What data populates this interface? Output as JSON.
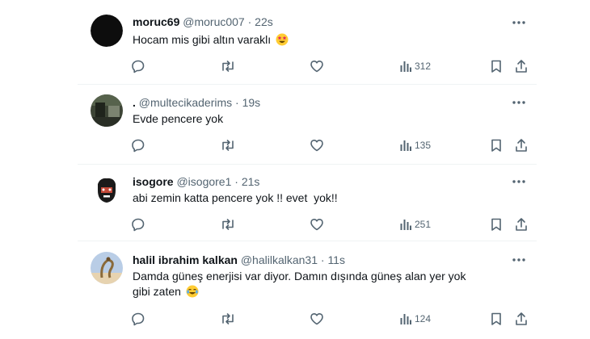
{
  "replies": [
    {
      "name": "moruc69",
      "handle": "@moruc007",
      "separator": "·",
      "time": "22s",
      "text": "Hocam mis gibi altın varaklı",
      "emoji": "star-struck-emoji",
      "views": "312"
    },
    {
      "name": ".",
      "handle": "@multecikaderims",
      "separator": "·",
      "time": "19s",
      "text": "Evde pencere yok",
      "emoji": "",
      "views": "135"
    },
    {
      "name": "isogore",
      "handle": "@isogore1",
      "separator": "·",
      "time": "21s",
      "text": "abi zemin katta pencere yok !! evet  yok!!",
      "emoji": "",
      "views": "251"
    },
    {
      "name": "halil ibrahim kalkan",
      "handle": "@halilkalkan31",
      "separator": "·",
      "time": "11s",
      "text": "Damda güneş enerjisi var diyor. Damın dışında güneş alan yer yok gibi zaten",
      "emoji": "crying-laughing-emoji",
      "views": "124"
    }
  ],
  "icons": {
    "reply": "reply-icon",
    "retweet": "retweet-icon",
    "like": "heart-icon",
    "views": "views-icon",
    "bookmark": "bookmark-icon",
    "share": "share-icon",
    "more": "more-icon"
  },
  "colors": {
    "text": "#0f1419",
    "secondary": "#536471",
    "divider": "#eff3f4"
  }
}
